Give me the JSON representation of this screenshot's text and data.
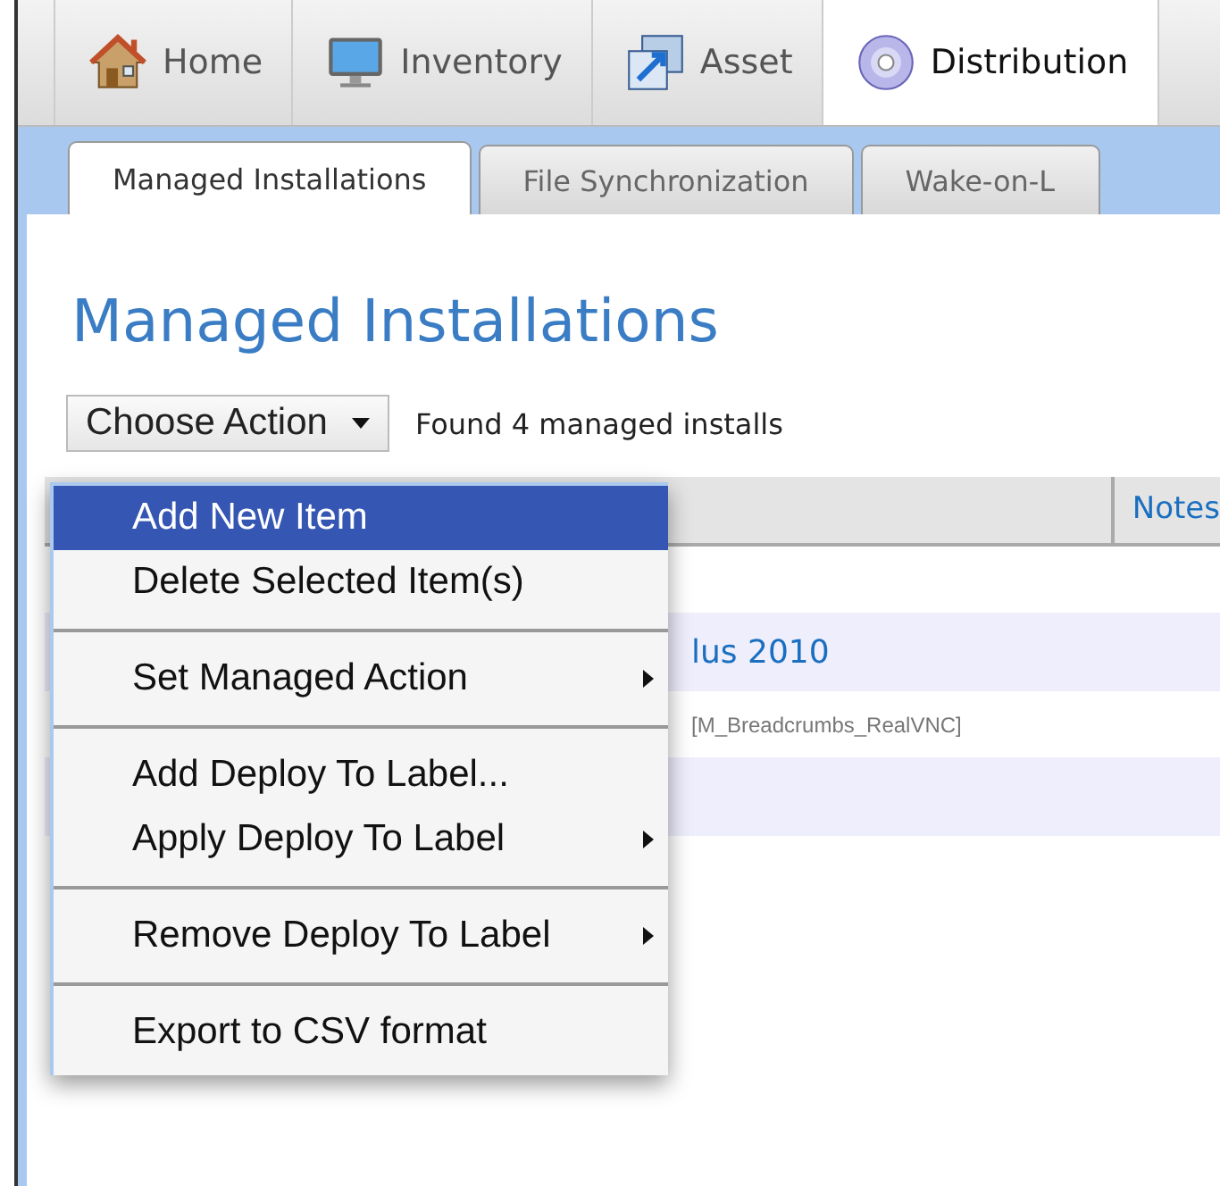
{
  "nav_tabs": [
    {
      "label": "Home",
      "kind": "home",
      "selected": false
    },
    {
      "label": "Inventory",
      "kind": "monitor",
      "selected": false
    },
    {
      "label": "Asset",
      "kind": "asset",
      "selected": false
    },
    {
      "label": "Distribution",
      "kind": "disc",
      "selected": true
    }
  ],
  "sub_tabs": [
    {
      "label": "Managed Installations",
      "selected": true
    },
    {
      "label": "File Synchronization",
      "selected": false
    },
    {
      "label": "Wake-on-L",
      "selected": false
    }
  ],
  "page_title": "Managed Installations",
  "action_button": {
    "label": "Choose Action"
  },
  "result_count": "Found 4 managed installs",
  "table": {
    "columns": [
      {
        "label": "Notes"
      }
    ],
    "rows": [
      {
        "kind": "empty"
      },
      {
        "text": "lus 2010",
        "kind": "link"
      },
      {
        "text": "[M_Breadcrumbs_RealVNC]",
        "kind": "label"
      },
      {
        "kind": "empty"
      }
    ]
  },
  "menu": {
    "groups": [
      [
        {
          "label": "Add New Item",
          "selected": true,
          "submenu": false
        },
        {
          "label": "Delete Selected Item(s)",
          "selected": false,
          "submenu": false
        }
      ],
      [
        {
          "label": "Set Managed Action",
          "selected": false,
          "submenu": true
        }
      ],
      [
        {
          "label": "Add Deploy To Label...",
          "selected": false,
          "submenu": false
        },
        {
          "label": "Apply Deploy To Label",
          "selected": false,
          "submenu": true
        }
      ],
      [
        {
          "label": "Remove Deploy To Label",
          "selected": false,
          "submenu": true
        }
      ],
      [
        {
          "label": "Export to CSV format",
          "selected": false,
          "submenu": false
        }
      ]
    ]
  }
}
